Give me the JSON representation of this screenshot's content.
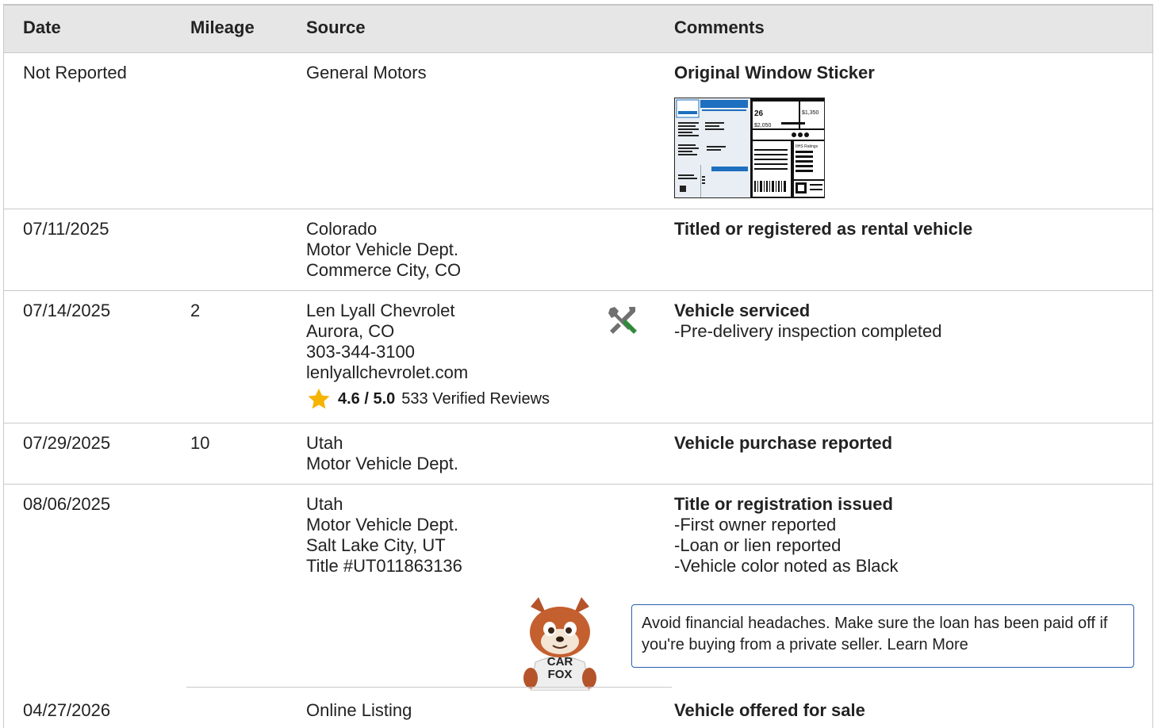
{
  "headers": {
    "date": "Date",
    "mileage": "Mileage",
    "source": "Source",
    "comments": "Comments"
  },
  "rows": [
    {
      "date": "Not Reported",
      "mileage": "",
      "source": [
        "General Motors"
      ],
      "comment_title": "Original Window Sticker",
      "sticker": {
        "mpg": "26",
        "save": "$1,350",
        "cost": "$2,050",
        "label": "IIHS Ratings"
      }
    },
    {
      "date": "07/11/2025",
      "mileage": "",
      "source": [
        "Colorado",
        "Motor Vehicle Dept.",
        "Commerce City, CO"
      ],
      "comment_title": "Titled or registered as rental vehicle"
    },
    {
      "date": "07/14/2025",
      "mileage": "2",
      "source": [
        "Len Lyall Chevrolet",
        "Aurora, CO",
        "303-344-3100",
        "lenlyallchevrolet.com"
      ],
      "rating": {
        "score": "4.6 / 5.0",
        "reviews": "533 Verified Reviews"
      },
      "icon": "service-tools-icon",
      "comment_title": "Vehicle serviced",
      "comment_items": [
        "Pre-delivery inspection completed"
      ]
    },
    {
      "date": "07/29/2025",
      "mileage": "10",
      "source": [
        "Utah",
        "Motor Vehicle Dept."
      ],
      "comment_title": "Vehicle purchase reported"
    },
    {
      "date": "08/06/2025",
      "mileage": "",
      "source": [
        "Utah",
        "Motor Vehicle Dept.",
        "Salt Lake City, UT",
        "Title #UT011863136"
      ],
      "comment_title": "Title or registration issued",
      "comment_items": [
        "First owner reported",
        "Loan or lien reported",
        "Vehicle color noted as Black"
      ],
      "tip": "Avoid financial headaches. Make sure the loan has been paid off if you're buying from a private seller. Learn More",
      "mascot_text": [
        "CAR",
        "FOX"
      ]
    },
    {
      "date": "04/27/2026",
      "mileage": "",
      "source": [
        "Online Listing"
      ],
      "comment_title": "Vehicle offered for sale"
    }
  ],
  "colors": {
    "accent_blue": "#2b5fad",
    "star": "#f5b400",
    "tool_green": "#2e8b3a"
  }
}
